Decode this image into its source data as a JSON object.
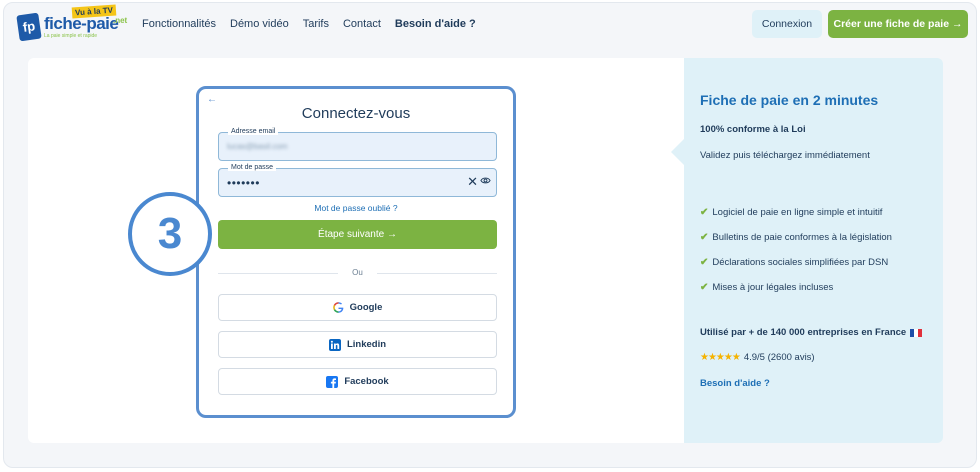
{
  "header": {
    "logo_mark": "fp",
    "logo_text": "fiche-paie",
    "logo_tv": "Vu à la TV",
    "logo_tld": ".net",
    "logo_tagline": "La paie simple et rapide",
    "nav": [
      {
        "label": "Fonctionnalités",
        "bold": false
      },
      {
        "label": "Démo vidéo",
        "bold": false
      },
      {
        "label": "Tarifs",
        "bold": false
      },
      {
        "label": "Contact",
        "bold": false
      },
      {
        "label": "Besoin d'aide ?",
        "bold": true
      }
    ],
    "login_label": "Connexion",
    "create_label": "Créer une fiche de paie →"
  },
  "login": {
    "back": "←",
    "title": "Connectez-vous",
    "email_label": "Adresse email",
    "email_value": "lucas@basil.com",
    "password_label": "Mot de passe",
    "password_value": "•••••••",
    "clear": "✕",
    "forgot": "Mot de passe oublié ?",
    "next_label": "Étape suivante →",
    "or": "Ou",
    "google": "Google",
    "linkedin": "Linkedin",
    "facebook": "Facebook"
  },
  "step_number": "3",
  "side": {
    "title": "Fiche de paie en 2 minutes",
    "subtitle": "100% conforme à la Loi",
    "description": "Validez puis téléchargez immédiatement",
    "check": "✔",
    "features": [
      "Logiciel de paie en ligne simple et intuitif",
      "Bulletins de paie conformes à la législation",
      "Déclarations sociales simplifiées par DSN",
      "Mises à jour légales incluses"
    ],
    "used_by": "Utilisé par + de 140 000 entreprises en France",
    "stars": "★★★★★",
    "rating": "4.9/5 (2600 avis)",
    "help": "Besoin d'aide ?"
  },
  "colors": {
    "accent_green": "#7cb342",
    "accent_blue": "#1e6fb5",
    "panel_bg": "#dff1f8",
    "step_blue": "#4a88d0"
  }
}
